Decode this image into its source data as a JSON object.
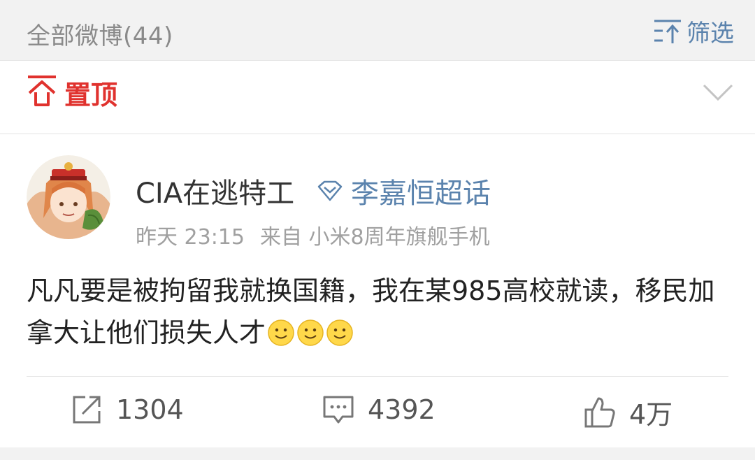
{
  "header": {
    "title": "全部微博(44)",
    "filter_label": "筛选",
    "filter_icon": "filter-icon",
    "accent_color": "#5b83ad"
  },
  "pinned": {
    "label": "置顶",
    "icon": "pin-top-icon",
    "color": "#e0322e"
  },
  "post": {
    "username": "CIA在逃特工",
    "super_topic": "李嘉恒超话",
    "time": "昨天 23:15",
    "source": "来自 小米8周年旗舰手机",
    "text": "凡凡要是被拘留我就换国籍，我在某985高校就读，移民加拿大让他们损失人才",
    "emoji": [
      "smile-emoji",
      "smile-emoji",
      "smile-emoji"
    ]
  },
  "actions": {
    "repost_count": "1304",
    "comment_count": "4392",
    "like_count": "4万"
  }
}
